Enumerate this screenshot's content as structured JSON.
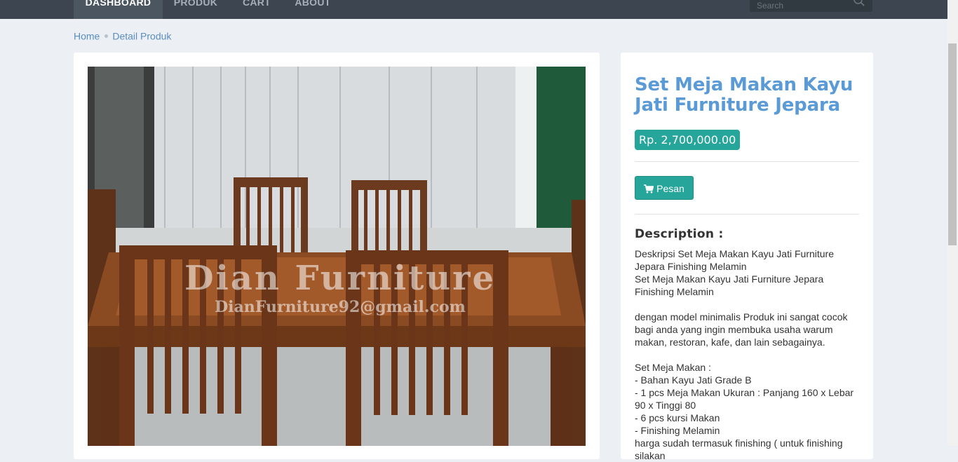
{
  "nav": {
    "items": [
      {
        "label": "DASHBOARD",
        "active": true
      },
      {
        "label": "PRODUK",
        "active": false
      },
      {
        "label": "CART",
        "active": false
      },
      {
        "label": "ABOUT",
        "active": false
      }
    ],
    "search": {
      "placeholder": "Search",
      "icon": "search-icon"
    }
  },
  "breadcrumb": {
    "home": "Home",
    "current": "Detail Produk"
  },
  "product": {
    "image": {
      "watermark_title": "Dian Furniture",
      "watermark_email": "DianFurniture92@gmail.com"
    },
    "title": "Set Meja Makan Kayu Jati Furniture Jepara",
    "price": "Rp. 2,700,000.00",
    "order_button": {
      "label": "Pesan",
      "icon": "shopping-cart-icon"
    },
    "description_heading": "Description :",
    "description": "Deskripsi Set Meja Makan Kayu Jati Furniture Jepara Finishing Melamin\nSet Meja Makan Kayu Jati Furniture Jepara Finishing Melamin\n\ndengan model minimalis Produk ini sangat cocok bagi anda yang ingin membuka usaha warum makan, restoran, kafe, dan lain sebagainya.\n\nSet Meja Makan :\n- Bahan Kayu Jati Grade B\n- 1 pcs Meja Makan Ukuran : Panjang 160 x Lebar 90 x Tinggi 80\n- 6 pcs kursi Makan\n- Finishing Melamin\nharga sudah termasuk finishing ( untuk finishing silakan"
  },
  "colors": {
    "nav_bg": "#3c4550",
    "accent_teal": "#26a69a",
    "title_blue": "#5a9ad6",
    "link_blue": "#5a8dc0",
    "page_bg": "#ecf0f5"
  }
}
